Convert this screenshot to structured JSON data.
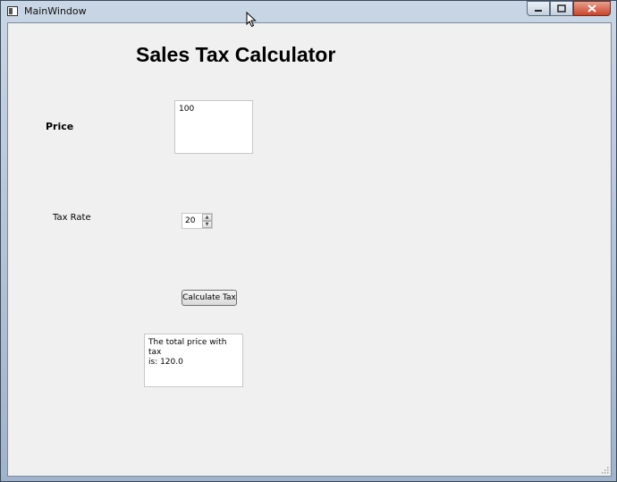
{
  "window": {
    "title": "MainWindow"
  },
  "form": {
    "heading": "Sales Tax Calculator",
    "price_label": "Price",
    "price_value": "100",
    "tax_rate_label": "Tax Rate",
    "tax_rate_value": "20",
    "calculate_button": "Calculate Tax",
    "result_line1": "The total price with tax",
    "result_line2": "is: 120.0"
  },
  "icons": [
    "app-icon",
    "minimize-icon",
    "maximize-icon",
    "close-icon",
    "spin-up-icon",
    "spin-down-icon",
    "mouse-cursor-icon",
    "resize-grip-icon"
  ]
}
